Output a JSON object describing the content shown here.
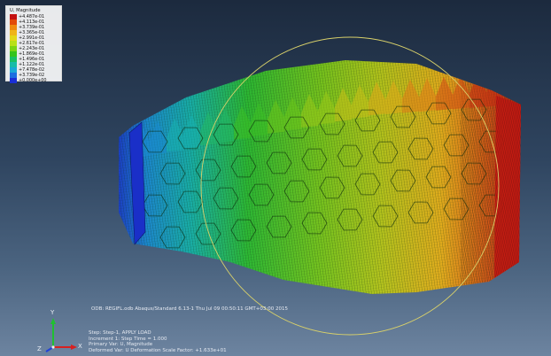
{
  "legend": {
    "title": "U, Magnitude",
    "entries": [
      {
        "label": "+4.487e-01",
        "color": "#c41010"
      },
      {
        "label": "+4.113e-01",
        "color": "#e24a0a"
      },
      {
        "label": "+3.739e-01",
        "color": "#ee8a10"
      },
      {
        "label": "+3.365e-01",
        "color": "#efb418"
      },
      {
        "label": "+2.991e-01",
        "color": "#e2d818"
      },
      {
        "label": "+2.617e-01",
        "color": "#b8e018"
      },
      {
        "label": "+2.243e-01",
        "color": "#7ad414"
      },
      {
        "label": "+1.869e-01",
        "color": "#34c41c"
      },
      {
        "label": "+1.496e-01",
        "color": "#18c064"
      },
      {
        "label": "+1.122e-01",
        "color": "#16bca8"
      },
      {
        "label": "+7.478e-02",
        "color": "#18a8d6"
      },
      {
        "label": "+3.739e-02",
        "color": "#1a6ee0"
      },
      {
        "label": "+0.000e+00",
        "color": "#1a2fd6"
      }
    ]
  },
  "status": {
    "odb": "ODB: REGIFL.odb    Abaqus/Standard 6.13-1    Thu Jul 09 00:50:11 GMT+03:00 2015",
    "step": "Step: Step-1, APPLY LOAD",
    "increment": "Increment     1: Step Time =    1.000",
    "primary": "Primary Var: U, Magnitude",
    "deformed": "Deformed Var: U   Deformation Scale Factor: +1.633e+01"
  },
  "triad": {
    "x": "X",
    "y": "Y",
    "z": "Z"
  },
  "colors": {
    "bg_top": "#1c2a3e",
    "bg_bottom": "#6d84a0",
    "circle": "#d8d06a"
  }
}
